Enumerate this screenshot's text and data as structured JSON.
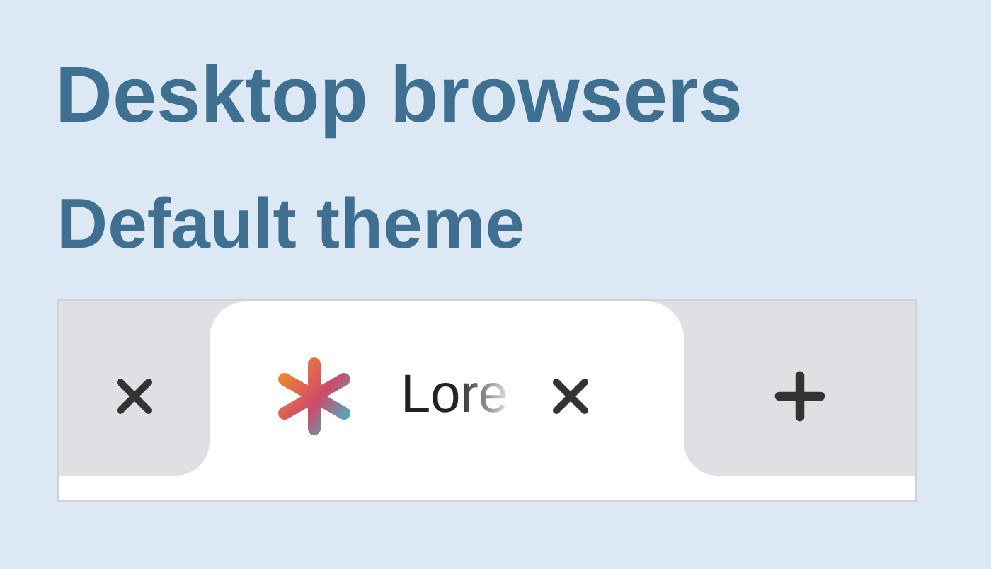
{
  "headings": [
    "Desktop browsers",
    "Default theme"
  ],
  "tabs": [
    {
      "selected": false
    },
    {
      "title": "Lore",
      "selected": true
    }
  ]
}
